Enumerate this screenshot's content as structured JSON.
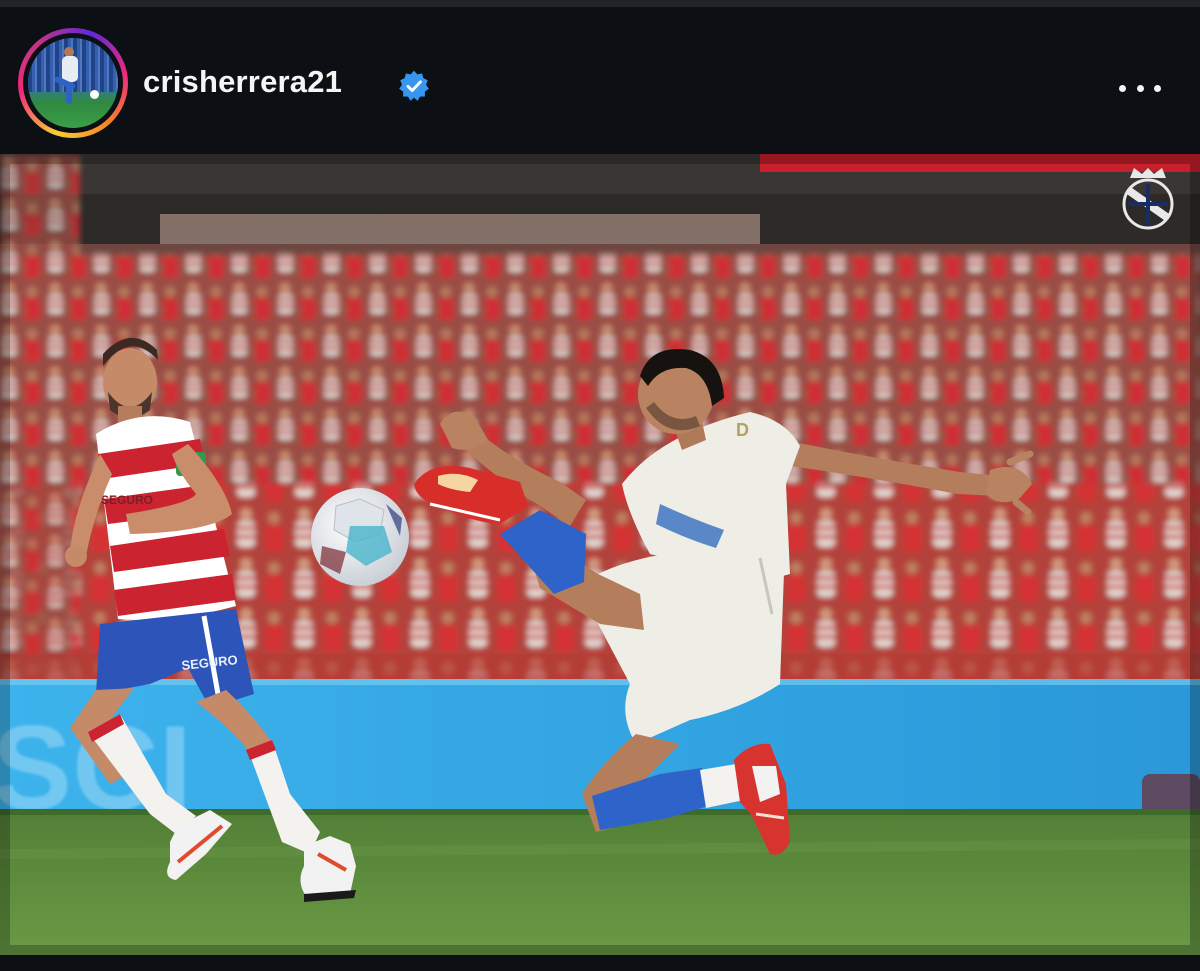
{
  "post": {
    "username": "crisherrera21",
    "verified": true,
    "more_icon": "more-horizontal-icon",
    "photo_description_icon": "club-crest-icon"
  },
  "photo": {
    "left_player_sponsor": "SEGURO",
    "player_shirt_text": "D"
  },
  "colors": {
    "header_bg": "#0c0f14",
    "verified_blue": "#3797f0",
    "home_red": "#c8202e",
    "away_white": "#efeee6",
    "sock_blue": "#2e63c9",
    "board_blue": "#34a7e6",
    "pitch_green": "#5a8c3a"
  }
}
